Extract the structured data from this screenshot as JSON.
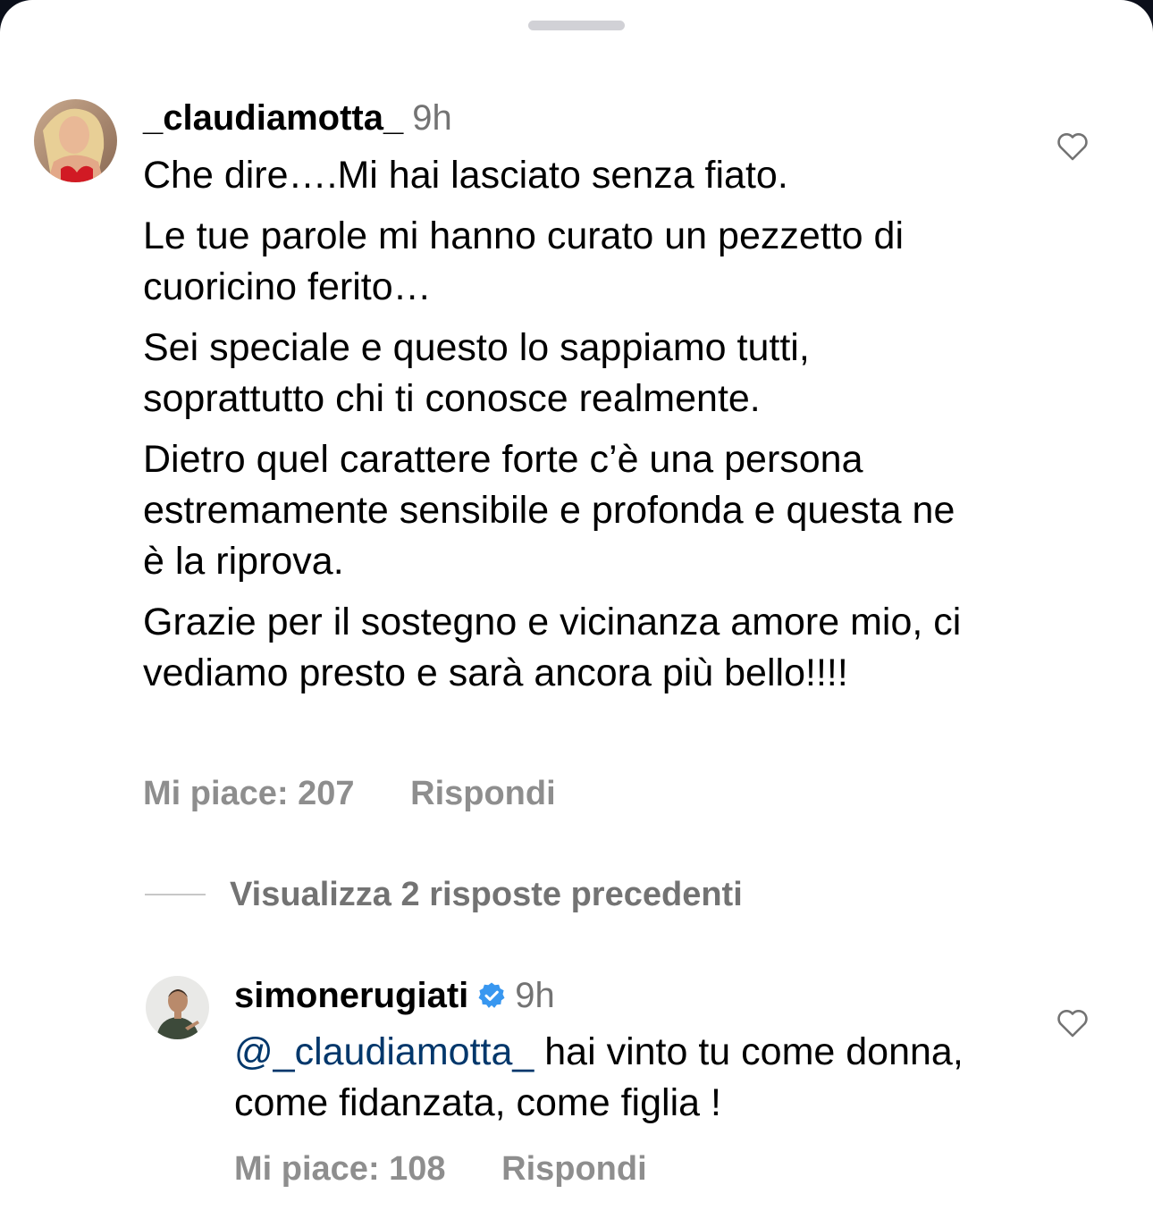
{
  "comments": [
    {
      "username": "_claudiamotta_",
      "time": "9h",
      "paragraphs": [
        "Che dire….Mi hai lasciato senza fiato.",
        "Le tue parole mi hanno curato un pezzetto di cuoricino ferito…",
        "Sei speciale e questo lo sappiamo tutti, soprattutto chi ti conosce realmente.",
        "Dietro quel carattere forte c’è una persona estremamente sensibile e profonda e questa ne è la riprova.",
        "Grazie per il sostegno e vicinanza amore mio, ci vediamo presto e sarà ancora più bello!!!!"
      ],
      "likes": "Mi piace: 207",
      "reply": "Rispondi"
    }
  ],
  "view_replies": "Visualizza 2 risposte precedenti",
  "reply_comment": {
    "username": "simonerugiati",
    "verified": true,
    "time": "9h",
    "mention": "@_claudiamotta_",
    "text": " hai vinto tu come donna, come fidanzata, come figlia !",
    "likes": "Mi piace: 108",
    "reply": "Rispondi"
  },
  "icons": {
    "like": "heart-outline-icon",
    "verified": "verified-badge-icon"
  },
  "colors": {
    "verified_blue": "#3897f0",
    "mention_blue": "#00376b",
    "secondary_text": "#737373"
  }
}
